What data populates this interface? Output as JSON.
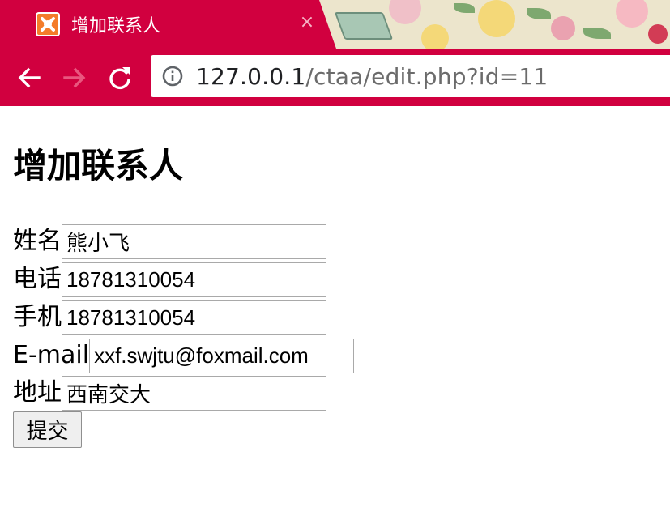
{
  "browser": {
    "tab": {
      "title": "增加联系人",
      "close_glyph": "×",
      "icon": "xampp-icon"
    },
    "address_bar": {
      "host": "127.0.0.1",
      "path": "/ctaa/edit.php?id=11"
    },
    "nav_icons": [
      "back-arrow-icon",
      "forward-arrow-icon",
      "reload-icon",
      "info-icon"
    ],
    "colors": {
      "theme_red": "#d1003f",
      "tab_title_text": "#ffffff"
    }
  },
  "page": {
    "title": "增加联系人",
    "fields": [
      {
        "label": "姓名",
        "value": "熊小飞"
      },
      {
        "label": "电话",
        "value": "18781310054"
      },
      {
        "label": "手机",
        "value": "18781310054"
      },
      {
        "label": "E-mail",
        "value": "xxf.swjtu@foxmail.com"
      },
      {
        "label": "地址",
        "value": "西南交大"
      }
    ],
    "submit_label": "提交"
  }
}
